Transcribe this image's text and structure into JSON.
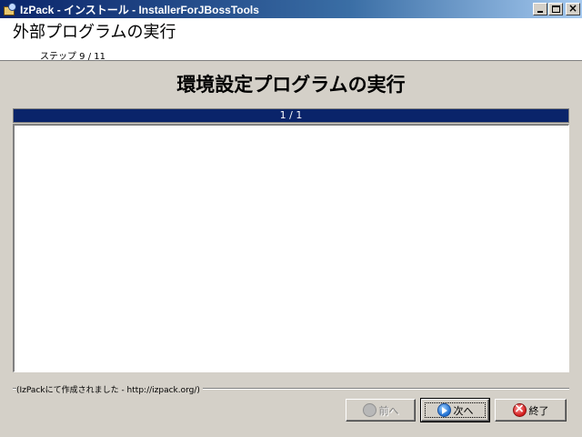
{
  "window": {
    "title": "IzPack - インストール - InstallerForJBossTools"
  },
  "header": {
    "panel_title": "外部プログラムの実行",
    "step": "ステップ 9 / 11"
  },
  "main": {
    "heading": "環境設定プログラムの実行",
    "progress_text": "1 / 1",
    "progress_fraction": 1.0,
    "output_text": ""
  },
  "footer": {
    "credit": "(IzPackにて作成されました - http://izpack.org/)",
    "prev_label": "前へ",
    "next_label": "次へ",
    "quit_label": "終了"
  },
  "colors": {
    "title_bar": "#0a246a",
    "progress_bar": "#0a246a",
    "window_bg": "#d4d0c8"
  },
  "icons": {
    "app": "package-icon",
    "prev": "back-arrow-icon",
    "next": "next-arrow-icon",
    "quit": "cancel-icon"
  }
}
